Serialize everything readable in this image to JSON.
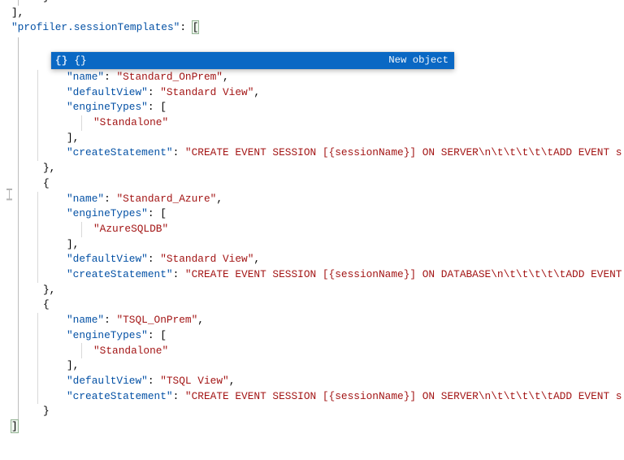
{
  "colors": {
    "key": "#0451a5",
    "string": "#a31515",
    "punctuation": "#000000",
    "suggest_bg": "#0a68c4",
    "bracket_match_bg": "#eef6ee",
    "bracket_match_border": "#93b393"
  },
  "suggest_widget": {
    "icon_glyph": "{}",
    "label": "{}",
    "detail": "New object"
  },
  "code": {
    "lines": [
      {
        "i": 1,
        "t": [
          [
            "p",
            "}"
          ]
        ]
      },
      {
        "i": 0,
        "t": [
          [
            "p",
            "],"
          ]
        ]
      },
      {
        "i": 0,
        "t": [
          [
            "k",
            "\"profiler.sessionTemplates\""
          ],
          [
            "p",
            ": "
          ],
          [
            "b",
            "["
          ]
        ]
      },
      {
        "i": 0,
        "t": []
      },
      {
        "i": 0,
        "t": []
      },
      {
        "i": 2,
        "t": [
          [
            "k",
            "\"name\""
          ],
          [
            "p",
            ": "
          ],
          [
            "s",
            "\"Standard_OnPrem\""
          ],
          [
            "p",
            ","
          ]
        ]
      },
      {
        "i": 2,
        "t": [
          [
            "k",
            "\"defaultView\""
          ],
          [
            "p",
            ": "
          ],
          [
            "s",
            "\"Standard View\""
          ],
          [
            "p",
            ","
          ]
        ]
      },
      {
        "i": 2,
        "t": [
          [
            "k",
            "\"engineTypes\""
          ],
          [
            "p",
            ": ["
          ]
        ]
      },
      {
        "i": 3,
        "t": [
          [
            "s",
            "\"Standalone\""
          ]
        ]
      },
      {
        "i": 2,
        "t": [
          [
            "p",
            "],"
          ]
        ]
      },
      {
        "i": 2,
        "t": [
          [
            "k",
            "\"createStatement\""
          ],
          [
            "p",
            ": "
          ],
          [
            "s",
            "\"CREATE EVENT SESSION [{sessionName}] ON SERVER\\n\\t\\t\\t\\t\\tADD EVENT s"
          ]
        ]
      },
      {
        "i": 1,
        "t": [
          [
            "p",
            "},"
          ]
        ]
      },
      {
        "i": 1,
        "t": [
          [
            "p",
            "{"
          ]
        ]
      },
      {
        "i": 2,
        "t": [
          [
            "k",
            "\"name\""
          ],
          [
            "p",
            ": "
          ],
          [
            "s",
            "\"Standard_Azure\""
          ],
          [
            "p",
            ","
          ]
        ]
      },
      {
        "i": 2,
        "t": [
          [
            "k",
            "\"engineTypes\""
          ],
          [
            "p",
            ": ["
          ]
        ]
      },
      {
        "i": 3,
        "t": [
          [
            "s",
            "\"AzureSQLDB\""
          ]
        ]
      },
      {
        "i": 2,
        "t": [
          [
            "p",
            "],"
          ]
        ]
      },
      {
        "i": 2,
        "t": [
          [
            "k",
            "\"defaultView\""
          ],
          [
            "p",
            ": "
          ],
          [
            "s",
            "\"Standard View\""
          ],
          [
            "p",
            ","
          ]
        ]
      },
      {
        "i": 2,
        "t": [
          [
            "k",
            "\"createStatement\""
          ],
          [
            "p",
            ": "
          ],
          [
            "s",
            "\"CREATE EVENT SESSION [{sessionName}] ON DATABASE\\n\\t\\t\\t\\t\\tADD EVENT"
          ]
        ]
      },
      {
        "i": 1,
        "t": [
          [
            "p",
            "},"
          ]
        ]
      },
      {
        "i": 1,
        "t": [
          [
            "p",
            "{"
          ]
        ]
      },
      {
        "i": 2,
        "t": [
          [
            "k",
            "\"name\""
          ],
          [
            "p",
            ": "
          ],
          [
            "s",
            "\"TSQL_OnPrem\""
          ],
          [
            "p",
            ","
          ]
        ]
      },
      {
        "i": 2,
        "t": [
          [
            "k",
            "\"engineTypes\""
          ],
          [
            "p",
            ": ["
          ]
        ]
      },
      {
        "i": 3,
        "t": [
          [
            "s",
            "\"Standalone\""
          ]
        ]
      },
      {
        "i": 2,
        "t": [
          [
            "p",
            "],"
          ]
        ]
      },
      {
        "i": 2,
        "t": [
          [
            "k",
            "\"defaultView\""
          ],
          [
            "p",
            ": "
          ],
          [
            "s",
            "\"TSQL View\""
          ],
          [
            "p",
            ","
          ]
        ]
      },
      {
        "i": 2,
        "t": [
          [
            "k",
            "\"createStatement\""
          ],
          [
            "p",
            ": "
          ],
          [
            "s",
            "\"CREATE EVENT SESSION [{sessionName}] ON SERVER\\n\\t\\t\\t\\t\\tADD EVENT s"
          ]
        ]
      },
      {
        "i": 1,
        "t": [
          [
            "p",
            "}"
          ]
        ]
      },
      {
        "i": 0,
        "t": [
          [
            "b",
            "]"
          ]
        ]
      }
    ]
  }
}
